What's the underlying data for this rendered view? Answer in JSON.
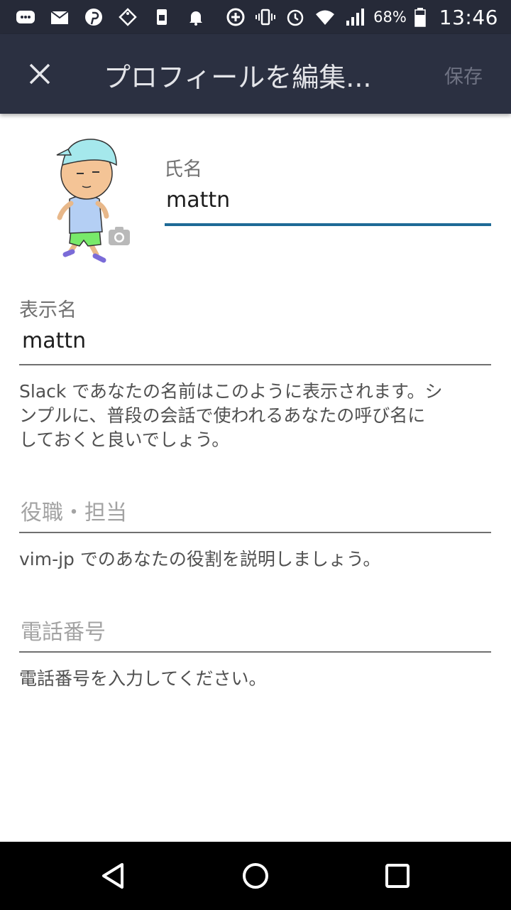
{
  "status_bar": {
    "icons": [
      "message-icon",
      "au-mail-icon",
      "pinterest-icon",
      "tag-icon",
      "sim-icon",
      "bell-icon",
      "data-saver-icon",
      "vibrate-icon",
      "alarm-icon",
      "wifi-icon",
      "signal-icon",
      "battery-icon"
    ],
    "battery_percent": "68%",
    "time": "13:46"
  },
  "app_bar": {
    "title": "プロフィールを編集...",
    "save_label": "保存",
    "background": "#2b3041"
  },
  "profile": {
    "avatar_icon": "avatar-image",
    "camera_icon": "camera-icon",
    "full_name": {
      "label": "氏名",
      "value": "mattn"
    },
    "display_name": {
      "label": "表示名",
      "value": "mattn",
      "helper_line1": "Slack であなたの名前はこのように表示されます。シ",
      "helper_line2": "ンプルに、普段の会話で使われるあなたの呼び名に",
      "helper_line3": "しておくと良いでしょう。"
    },
    "title": {
      "placeholder": "役職・担当",
      "helper": "vim-jp でのあなたの役割を説明しましょう。"
    },
    "phone": {
      "placeholder": "電話番号",
      "helper": "電話番号を入力してください。"
    }
  },
  "colors": {
    "accent": "#1e6a96",
    "status_bar": "#262a38"
  },
  "nav_bar": {
    "icons": [
      "back-icon",
      "home-icon",
      "recents-icon"
    ]
  }
}
